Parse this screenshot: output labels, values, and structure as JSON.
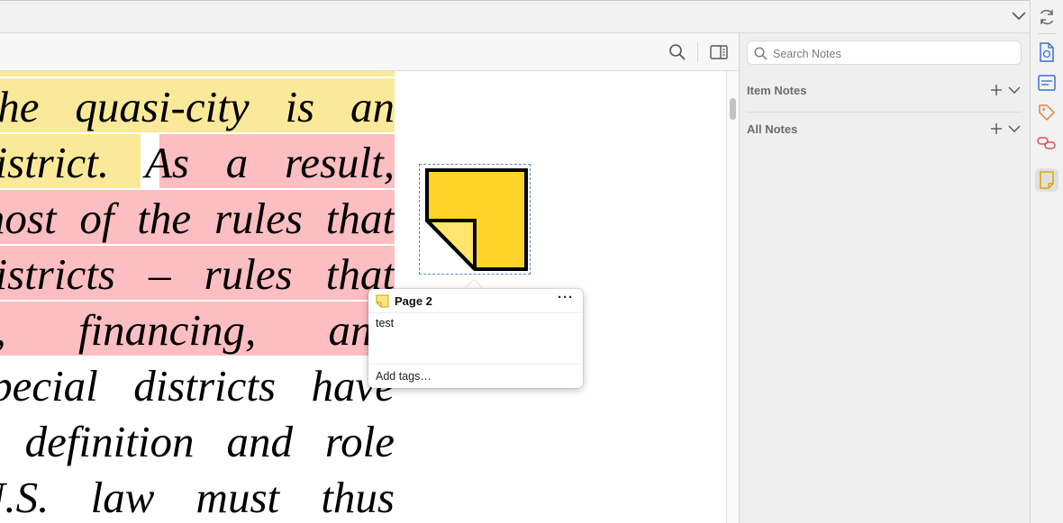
{
  "toolbar": {
    "search_icon": "search-icon",
    "sidebar_toggle_icon": "sidebar-toggle-icon",
    "tabs_menu_icon": "chevron-down-icon"
  },
  "document": {
    "lines": [
      "",
      "The quasi-city is an",
      "district.   As a result,",
      "most of the rules that",
      "districts – rules that",
      "n,  financing,  and",
      "special districts have",
      "e definition and role",
      "U.S. law must thus"
    ],
    "highlight_colors": {
      "yellow": "#fbe99a",
      "red": "#fcbec1"
    }
  },
  "annotation": {
    "type": "note",
    "color": "#ffd42a",
    "popup": {
      "title": "Page 2",
      "menu": "···",
      "text": "test",
      "tags_placeholder": "Add tags…"
    }
  },
  "notes_pane": {
    "search_placeholder": "Search Notes",
    "sections": [
      {
        "title": "Item Notes"
      },
      {
        "title": "All Notes"
      }
    ]
  },
  "rail": {
    "items": [
      {
        "icon": "sync-icon"
      },
      {
        "icon": "info-icon"
      },
      {
        "icon": "abstract-icon"
      },
      {
        "icon": "tag-icon"
      },
      {
        "icon": "related-icon"
      },
      {
        "icon": "notes-icon",
        "active": true
      }
    ]
  }
}
